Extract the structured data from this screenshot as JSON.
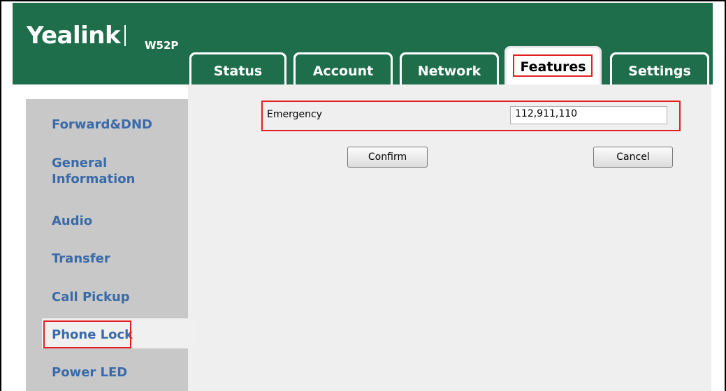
{
  "header": {
    "brand": "Yealink",
    "model": "W52P"
  },
  "tabs": [
    {
      "label": "Status",
      "active": false
    },
    {
      "label": "Account",
      "active": false
    },
    {
      "label": "Network",
      "active": false
    },
    {
      "label": "Features",
      "active": true
    },
    {
      "label": "Settings",
      "active": false
    }
  ],
  "sidebar": {
    "items": [
      {
        "label": "Forward&DND"
      },
      {
        "label": "General Information"
      },
      {
        "label": "Audio"
      },
      {
        "label": "Transfer"
      },
      {
        "label": "Call Pickup"
      },
      {
        "label": "Phone Lock",
        "selected": true
      },
      {
        "label": "Power LED"
      }
    ]
  },
  "form": {
    "emergency_label": "Emergency",
    "emergency_value": "112,911,110",
    "confirm_label": "Confirm",
    "cancel_label": "Cancel"
  },
  "colors": {
    "header_green": "#1e6e4b",
    "sidebar_gray": "#c8c8c8",
    "link_blue": "#3a6aa8",
    "highlight_red": "#e02020"
  }
}
